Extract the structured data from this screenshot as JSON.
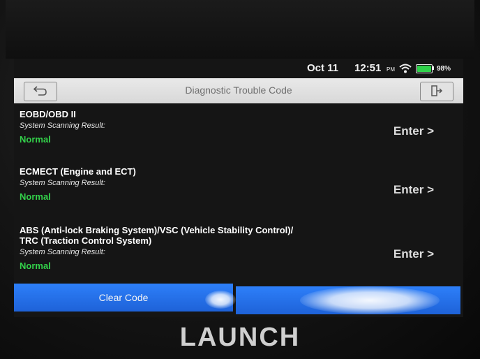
{
  "status_bar": {
    "date": "Oct 11",
    "time": "12:51",
    "am_pm": "PM",
    "battery_percent": "98%",
    "battery_level": 0.98
  },
  "title_bar": {
    "title": "Diagnostic Trouble Code"
  },
  "results": [
    {
      "system": "EOBD/OBD II",
      "scan_label": "System Scanning Result:",
      "status": "Normal",
      "enter_label": "Enter >"
    },
    {
      "system": "ECMECT (Engine and ECT)",
      "scan_label": "System Scanning Result:",
      "status": "Normal",
      "enter_label": "Enter >"
    },
    {
      "system": "ABS (Anti-lock Braking System)/VSC (Vehicle Stability Control)/\nTRC (Traction Control System)",
      "scan_label": "System Scanning Result:",
      "status": "Normal",
      "enter_label": "Enter >"
    }
  ],
  "bottom_buttons": {
    "clear_code": "Clear Code"
  },
  "brand": "LAUNCH",
  "colors": {
    "status_normal": "#33d04a",
    "button_blue": "#1e6ff0",
    "title_bar": "#e0e0e0"
  }
}
